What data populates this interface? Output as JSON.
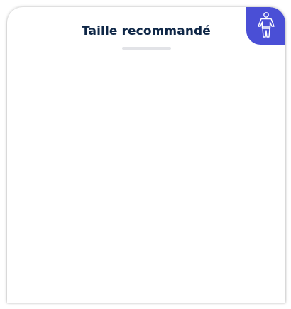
{
  "panel": {
    "title": "Taille recommandé"
  },
  "icons": {
    "body_button": "person-body-icon"
  },
  "colors": {
    "title": "#0f2747",
    "accent": "#4a4fd6",
    "divider": "#e2e3e7"
  }
}
